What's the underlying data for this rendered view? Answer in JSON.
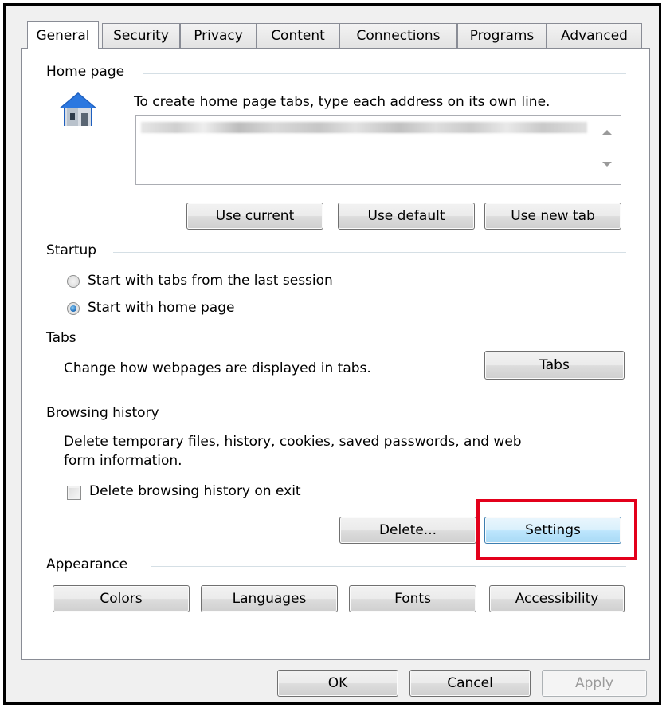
{
  "tabs": [
    "General",
    "Security",
    "Privacy",
    "Content",
    "Connections",
    "Programs",
    "Advanced"
  ],
  "active_tab": "General",
  "home_page": {
    "title": "Home page",
    "instruction": "To create home page tabs, type each address on its own line.",
    "buttons": {
      "use_current": "Use current",
      "use_default": "Use default",
      "use_new_tab": "Use new tab"
    }
  },
  "startup": {
    "title": "Startup",
    "options": [
      "Start with tabs from the last session",
      "Start with home page"
    ],
    "selected": "Start with home page"
  },
  "tabs_section": {
    "title": "Tabs",
    "description": "Change how webpages are displayed in tabs.",
    "button": "Tabs"
  },
  "browsing_history": {
    "title": "Browsing history",
    "description_line1": "Delete temporary files, history, cookies, saved passwords, and web",
    "description_line2": "form information.",
    "checkbox_label": "Delete browsing history on exit",
    "checkbox_checked": false,
    "delete_button": "Delete...",
    "settings_button": "Settings"
  },
  "appearance": {
    "title": "Appearance",
    "buttons": {
      "colors": "Colors",
      "languages": "Languages",
      "fonts": "Fonts",
      "accessibility": "Accessibility"
    }
  },
  "footer": {
    "ok": "OK",
    "cancel": "Cancel",
    "apply": "Apply"
  },
  "colors": {
    "highlight": "#e3001b",
    "focus_blue": "#3c7fb1",
    "radio_blue": "#2a78c2",
    "house_blue": "#1e5fbf"
  },
  "icons": [
    "house-icon",
    "scroll-up-arrow-icon",
    "scroll-down-arrow-icon"
  ]
}
